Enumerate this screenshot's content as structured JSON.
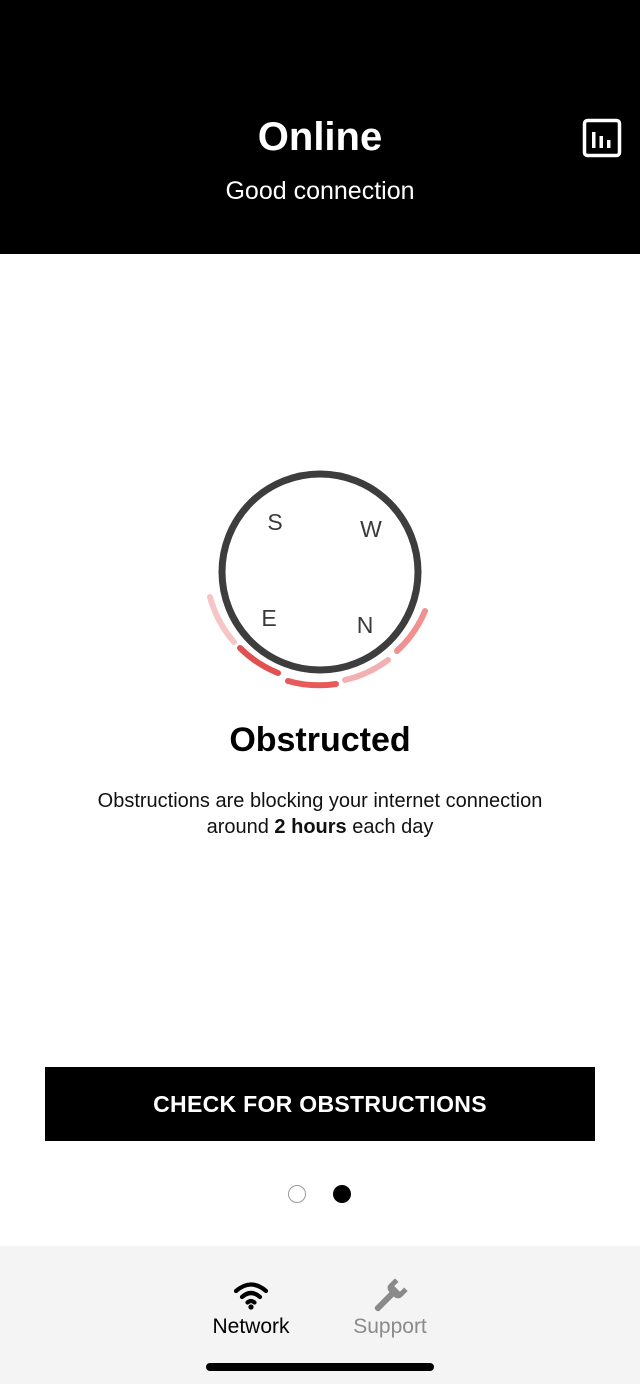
{
  "header": {
    "title": "Online",
    "subtitle": "Good connection",
    "stats_icon": "bar-chart-icon"
  },
  "compass": {
    "directions": [
      "S",
      "W",
      "E",
      "N"
    ],
    "ring_color": "#3d3d3d",
    "obstruction_colors": [
      "#f6c6c6",
      "#e05050",
      "#e85a5a",
      "#f2b0b0",
      "#f09090"
    ]
  },
  "status": {
    "title": "Obstructed",
    "line1": "Obstructions are blocking your internet connection",
    "line2_prefix": "around ",
    "line2_bold": "2 hours",
    "line2_suffix": " each day"
  },
  "cta": {
    "label": "CHECK FOR OBSTRUCTIONS"
  },
  "pagination": {
    "count": 2,
    "active_index": 1
  },
  "tabs": [
    {
      "label": "Network",
      "icon": "wifi-icon",
      "active": true
    },
    {
      "label": "Support",
      "icon": "wrench-icon",
      "active": false
    }
  ],
  "colors": {
    "header_bg": "#000000",
    "tab_active": "#000000",
    "tab_inactive": "#8a8a8a",
    "tabbar_bg": "#f4f4f4"
  }
}
